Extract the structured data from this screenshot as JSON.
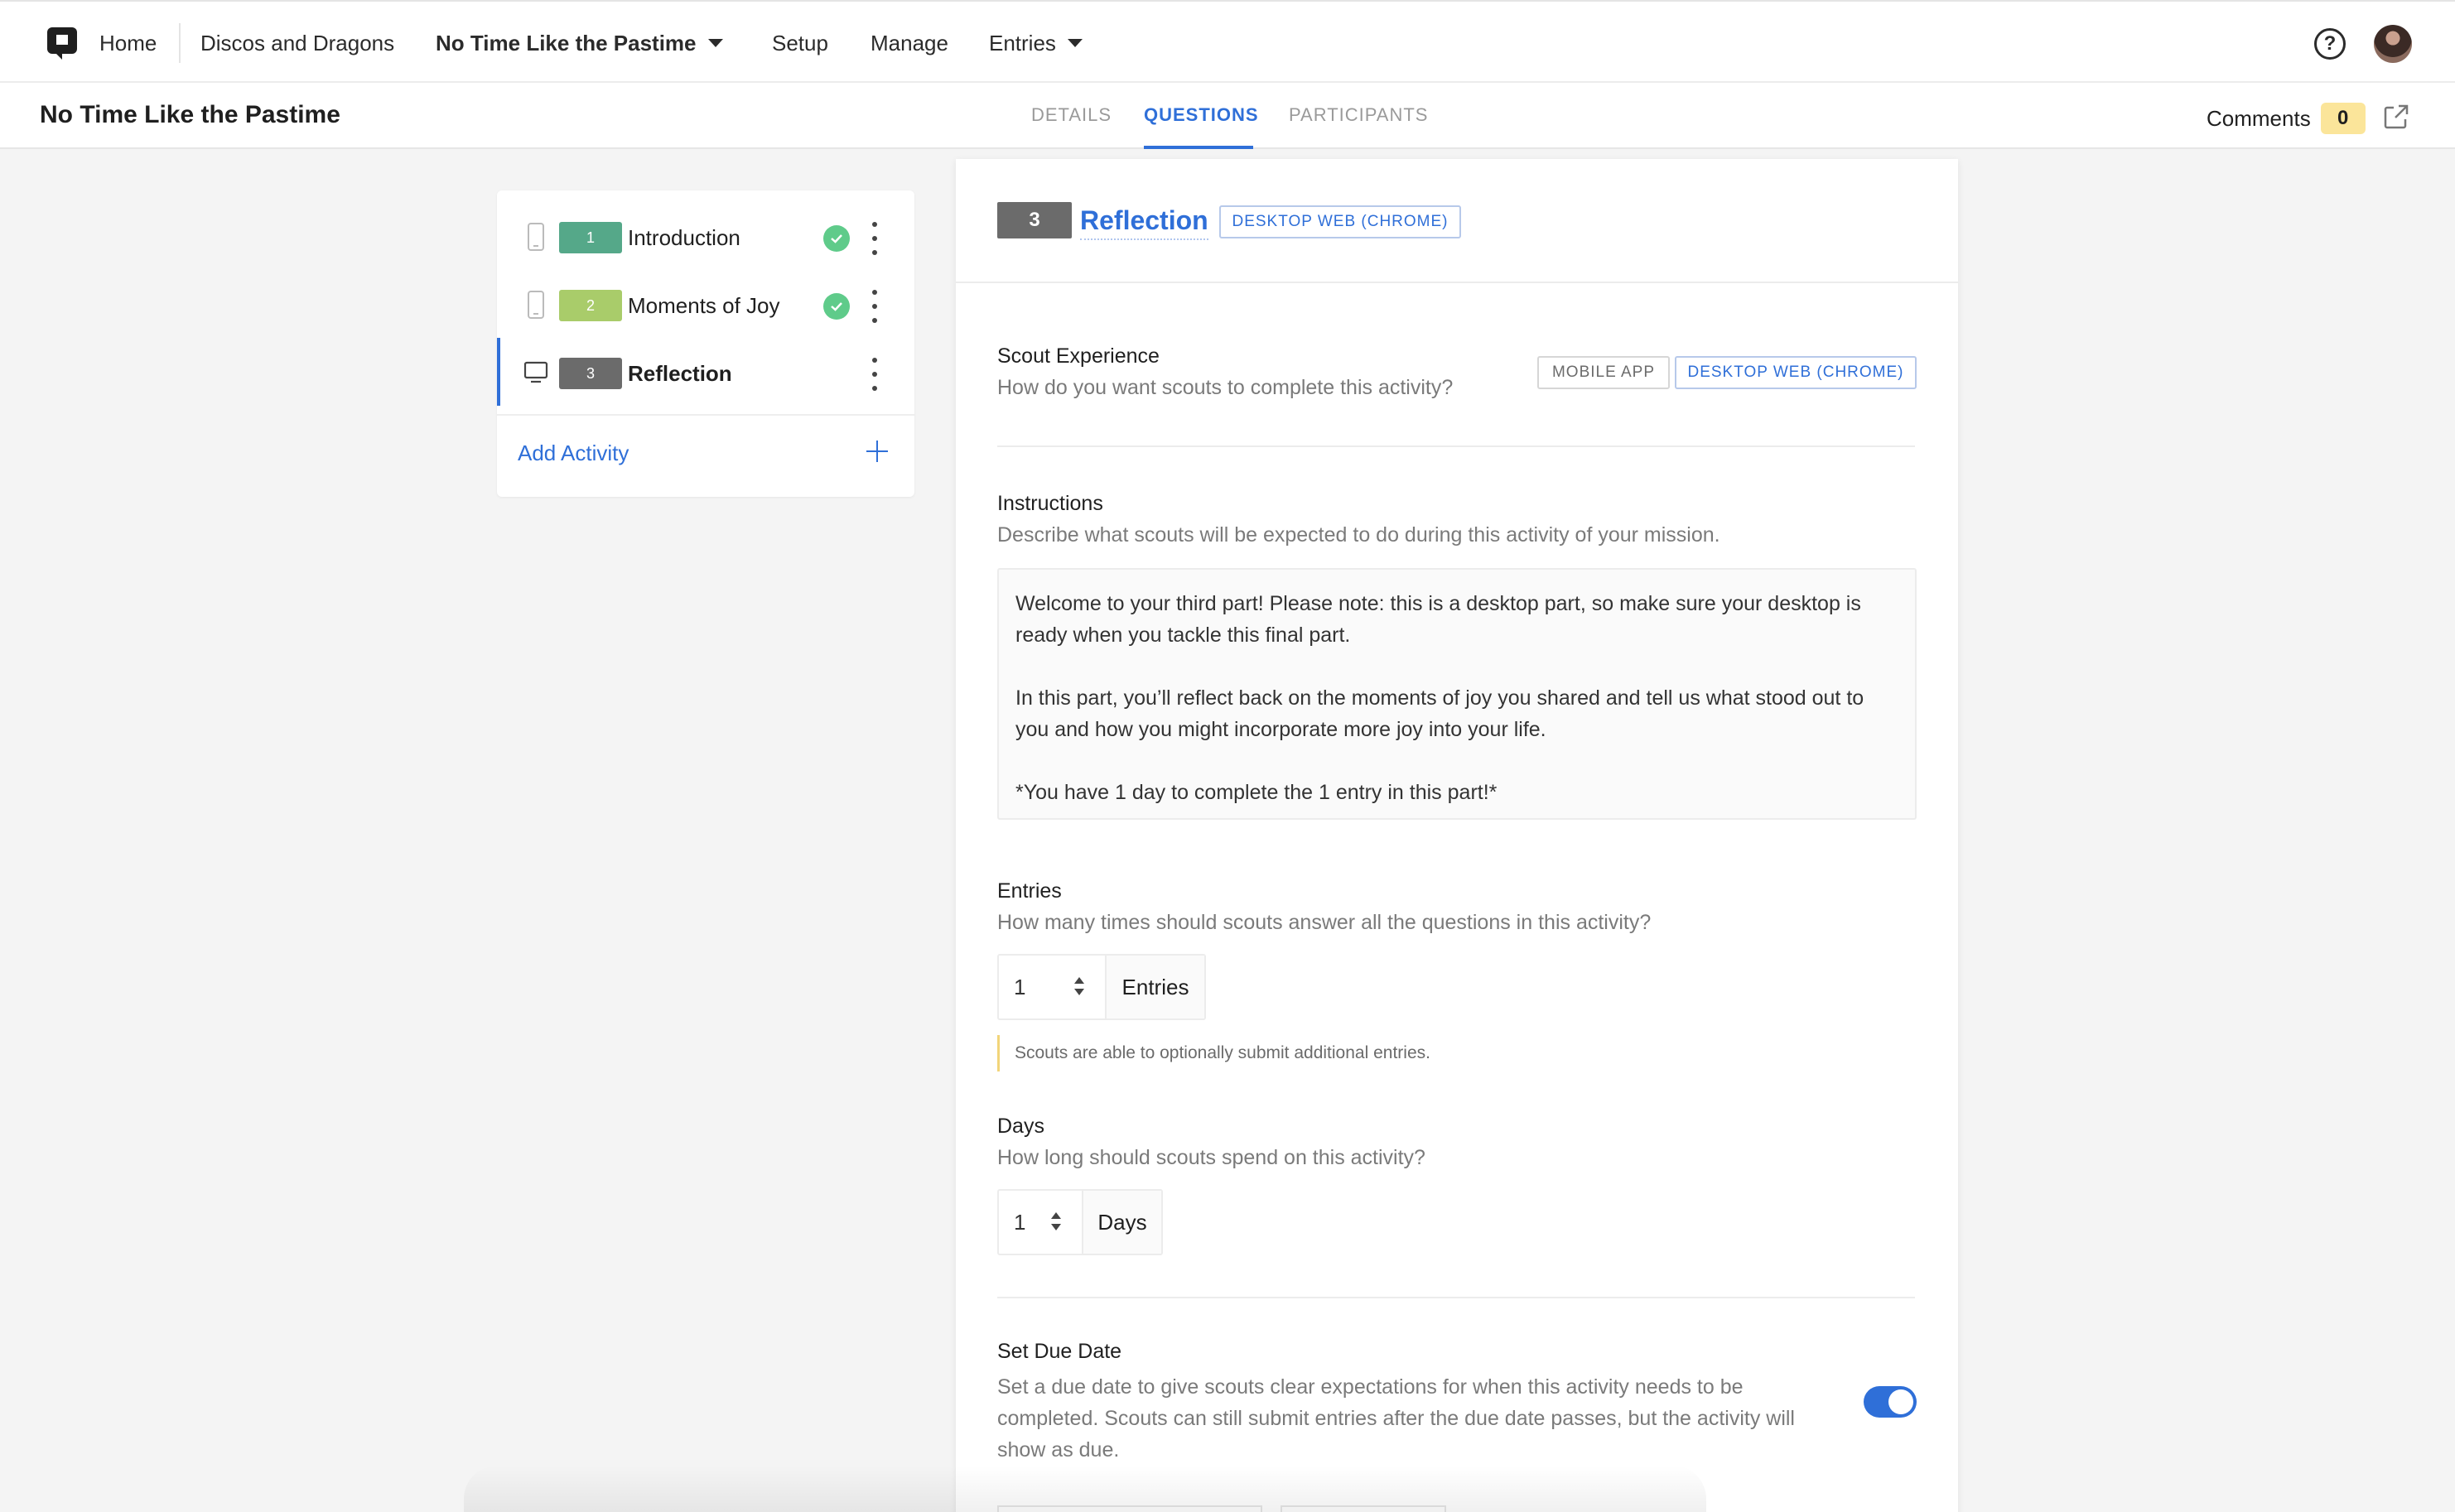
{
  "nav": {
    "home": "Home",
    "project": "Discos and Dragons",
    "mission": "No Time Like the Pastime",
    "setup": "Setup",
    "manage": "Manage",
    "entries": "Entries",
    "help_icon": "?"
  },
  "subheader": {
    "title": "No Time Like the Pastime",
    "tabs": [
      "DETAILS",
      "QUESTIONS",
      "PARTICIPANTS"
    ],
    "active_tab": "QUESTIONS",
    "comments_label": "Comments",
    "comments_count": "0"
  },
  "sidebar": {
    "activities": [
      {
        "num": "1",
        "label": "Introduction",
        "device": "mobile-icon",
        "color": "#55a889",
        "complete": true
      },
      {
        "num": "2",
        "label": "Moments of Joy",
        "device": "mobile-icon",
        "color": "#a9cc6a",
        "complete": true
      },
      {
        "num": "3",
        "label": "Reflection",
        "device": "desktop-icon",
        "color": "#6b6b6b",
        "complete": false
      }
    ],
    "add_activity": "Add Activity"
  },
  "main": {
    "badge": "3",
    "title": "Reflection",
    "platform_pill": "DESKTOP WEB (CHROME)",
    "scout_experience": {
      "label": "Scout Experience",
      "sub": "How do you want scouts to complete this activity?",
      "options": [
        "MOBILE APP",
        "DESKTOP WEB (CHROME)"
      ],
      "selected": "DESKTOP WEB (CHROME)"
    },
    "instructions": {
      "label": "Instructions",
      "sub": "Describe what scouts will be expected to do during this activity of your mission.",
      "p1": "Welcome to your third part! Please note: this is a desktop part, so make sure your desktop is ready when you tackle this final part.",
      "p2": "In this part, you’ll reflect back on the moments of joy you shared and tell us what stood out to you and how you might incorporate more joy into your life.",
      "p3": "*You have 1 day to complete the 1 entry in this part!*"
    },
    "entries": {
      "label": "Entries",
      "sub": "How many times should scouts answer all the questions in this activity?",
      "value": "1",
      "unit": "Entries",
      "note": "Scouts are able to optionally submit additional entries."
    },
    "days": {
      "label": "Days",
      "sub": "How long should scouts spend on this activity?",
      "value": "1",
      "unit": "Days"
    },
    "due_date": {
      "label": "Set Due Date",
      "sub": "Set a due date to give scouts clear expectations for when this activity needs to be completed. Scouts can still submit entries after the due date passes, but the activity will show as due.",
      "enabled": true
    }
  },
  "colors": {
    "accent": "#2f6fd8",
    "success": "#5fcb8a",
    "badge_yellow": "#fbe59a"
  }
}
